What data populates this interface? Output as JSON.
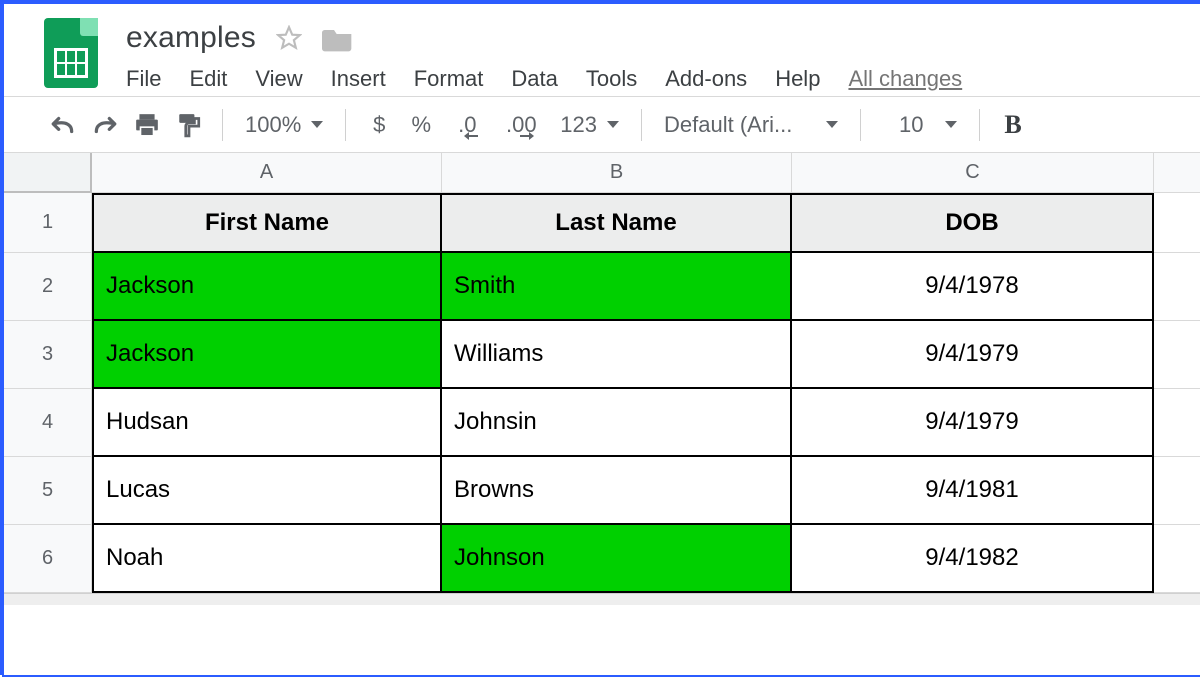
{
  "doc": {
    "title": "examples"
  },
  "menu": {
    "file": "File",
    "edit": "Edit",
    "view": "View",
    "insert": "Insert",
    "format": "Format",
    "data": "Data",
    "tools": "Tools",
    "addons": "Add-ons",
    "help": "Help",
    "saved": "All changes"
  },
  "toolbar": {
    "zoom": "100%",
    "currency": "$",
    "percent": "%",
    "dec_less": ".0",
    "dec_more": ".00",
    "more_formats": "123",
    "font": "Default (Ari...",
    "font_size": "10",
    "bold": "B"
  },
  "columns": [
    "A",
    "B",
    "C"
  ],
  "rows": [
    "1",
    "2",
    "3",
    "4",
    "5",
    "6"
  ],
  "table": {
    "headers": {
      "A": "First Name",
      "B": "Last Name",
      "C": "DOB"
    },
    "data": [
      {
        "A": "Jackson",
        "B": "Smith",
        "C": "9/4/1978",
        "hl": {
          "A": true,
          "B": true,
          "C": false
        }
      },
      {
        "A": "Jackson",
        "B": "Williams",
        "C": "9/4/1979",
        "hl": {
          "A": true,
          "B": false,
          "C": false
        }
      },
      {
        "A": "Hudsan",
        "B": "Johnsin",
        "C": "9/4/1979",
        "hl": {
          "A": false,
          "B": false,
          "C": false
        }
      },
      {
        "A": "Lucas",
        "B": "Browns",
        "C": "9/4/1981",
        "hl": {
          "A": false,
          "B": false,
          "C": false
        }
      },
      {
        "A": "Noah",
        "B": "Johnson",
        "C": "9/4/1982",
        "hl": {
          "A": false,
          "B": true,
          "C": false
        }
      }
    ]
  },
  "colors": {
    "highlight": "#00d000",
    "brand": "#0f9d58"
  }
}
